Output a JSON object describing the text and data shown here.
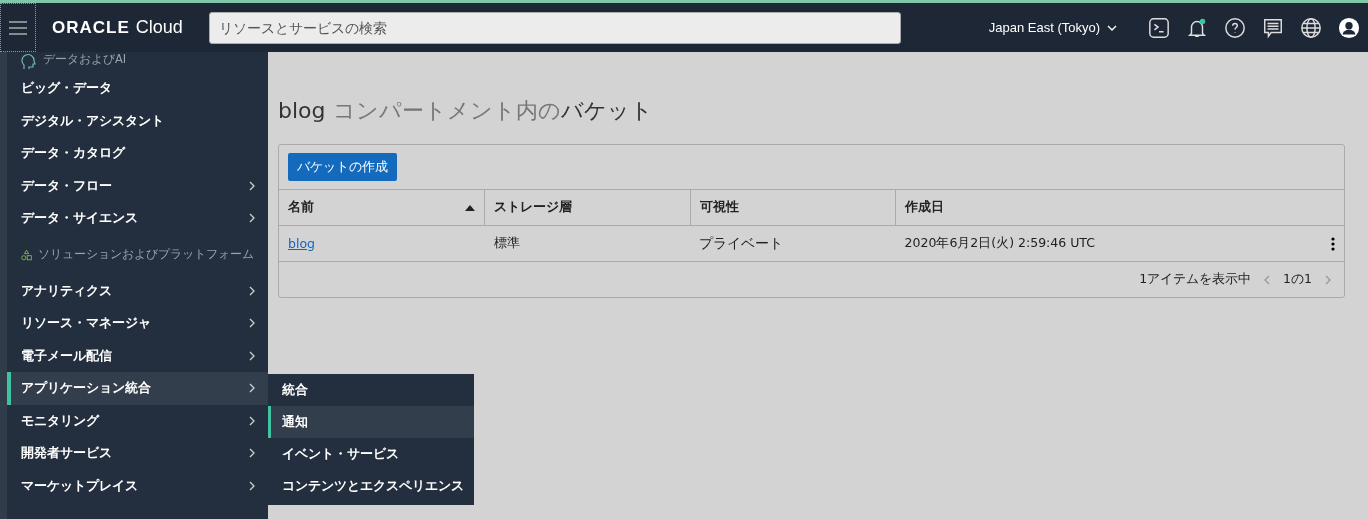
{
  "header": {
    "logo": "ORACLE",
    "product": "Cloud",
    "search": {
      "placeholder": "リソースとサービスの検索"
    },
    "region": "Japan East (Tokyo)",
    "notification_dot": true
  },
  "nav": {
    "sections": [
      {
        "heading": "データおよびAI",
        "items": [
          {
            "label": "ビッグ・データ",
            "has_submenu": false,
            "selected": false
          },
          {
            "label": "デジタル・アシスタント",
            "has_submenu": false,
            "selected": false
          },
          {
            "label": "データ・カタログ",
            "has_submenu": false,
            "selected": false
          },
          {
            "label": "データ・フロー",
            "has_submenu": true,
            "selected": false
          },
          {
            "label": "データ・サイエンス",
            "has_submenu": true,
            "selected": false
          }
        ]
      },
      {
        "heading": "ソリューションおよびプラットフォーム",
        "items": [
          {
            "label": "アナリティクス",
            "has_submenu": true,
            "selected": false
          },
          {
            "label": "リソース・マネージャ",
            "has_submenu": true,
            "selected": false
          },
          {
            "label": "電子メール配信",
            "has_submenu": true,
            "selected": false
          },
          {
            "label": "アプリケーション統合",
            "has_submenu": true,
            "selected": true
          },
          {
            "label": "モニタリング",
            "has_submenu": true,
            "selected": false
          },
          {
            "label": "開発者サービス",
            "has_submenu": true,
            "selected": false
          },
          {
            "label": "マーケットプレイス",
            "has_submenu": true,
            "selected": false
          }
        ]
      }
    ]
  },
  "submenu": {
    "items": [
      {
        "label": "統合",
        "selected": false
      },
      {
        "label": "通知",
        "selected": true
      },
      {
        "label": "イベント・サービス",
        "selected": false
      },
      {
        "label": "コンテンツとエクスペリエンス",
        "selected": false
      }
    ]
  },
  "page": {
    "title": {
      "compartment": "blog",
      "middle": "コンパートメント内の",
      "end": "バケット"
    },
    "create_button": "バケットの作成",
    "table": {
      "columns": [
        {
          "label": "名前",
          "sorted": true
        },
        {
          "label": "ストレージ層",
          "sorted": false
        },
        {
          "label": "可視性",
          "sorted": false
        },
        {
          "label": "作成日",
          "sorted": false
        }
      ],
      "rows": [
        {
          "name": "blog",
          "tier": "標準",
          "visibility": "プライベート",
          "created": "2020年6月2日(火) 2:59:46 UTC"
        }
      ]
    },
    "footer": {
      "count": "1アイテムを表示中",
      "pages": "1の1"
    }
  }
}
